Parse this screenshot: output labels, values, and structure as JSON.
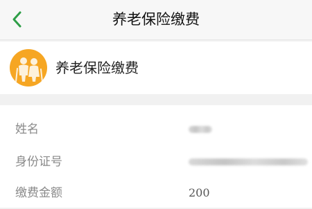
{
  "nav": {
    "title": "养老保险缴费",
    "back_icon": "chevron-left-icon",
    "back_color": "#2e9e47"
  },
  "header": {
    "service_name": "养老保险缴费",
    "icon": "elderly-couple-icon",
    "icon_color": "#f6a623"
  },
  "info": {
    "rows": [
      {
        "label": "姓名",
        "value": "",
        "masked": true
      },
      {
        "label": "身份证号",
        "value": "",
        "masked": true
      },
      {
        "label": "缴费金额",
        "value": "200",
        "masked": false
      }
    ]
  }
}
